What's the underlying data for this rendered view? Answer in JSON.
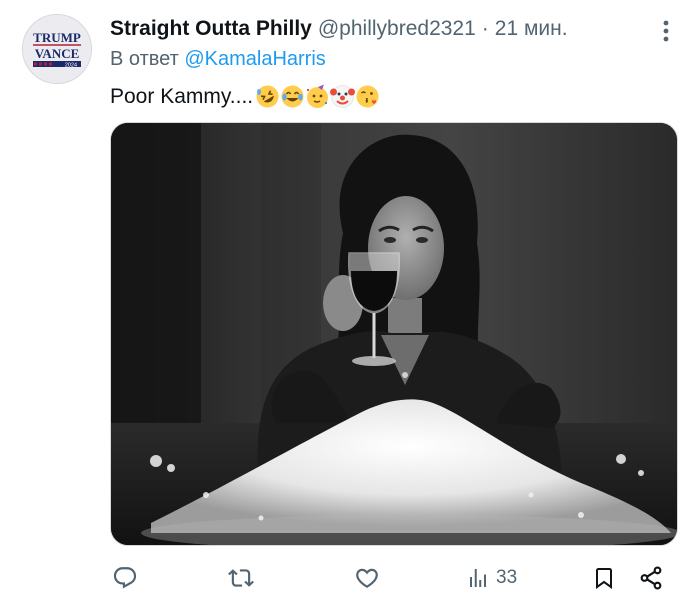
{
  "author": {
    "display_name": "Straight Outta Philly",
    "handle": "@phillybred2321",
    "separator": "·",
    "time": "21 мин.",
    "avatar_text": {
      "line1": "TRUMP",
      "line2": "VANCE",
      "year": "2024"
    }
  },
  "reply": {
    "prefix": "В ответ",
    "mention": "@KamalaHarris"
  },
  "tweet": {
    "text": "Poor Kammy....",
    "emojis": [
      "rolling-on-floor-laughing",
      "tears-of-joy",
      "partying-face",
      "clown-face",
      "face-blowing-kiss"
    ]
  },
  "media": {
    "type": "photo",
    "style": "black-and-white"
  },
  "actions": {
    "reply_icon": "reply-icon",
    "retweet_icon": "retweet-icon",
    "like_icon": "heart-icon",
    "views_icon": "views-icon",
    "views_count": "33",
    "bookmark_icon": "bookmark-icon",
    "share_icon": "share-icon"
  },
  "colors": {
    "link": "#1d9bf0",
    "secondary_text": "#536471",
    "primary_text": "#0f1419"
  }
}
